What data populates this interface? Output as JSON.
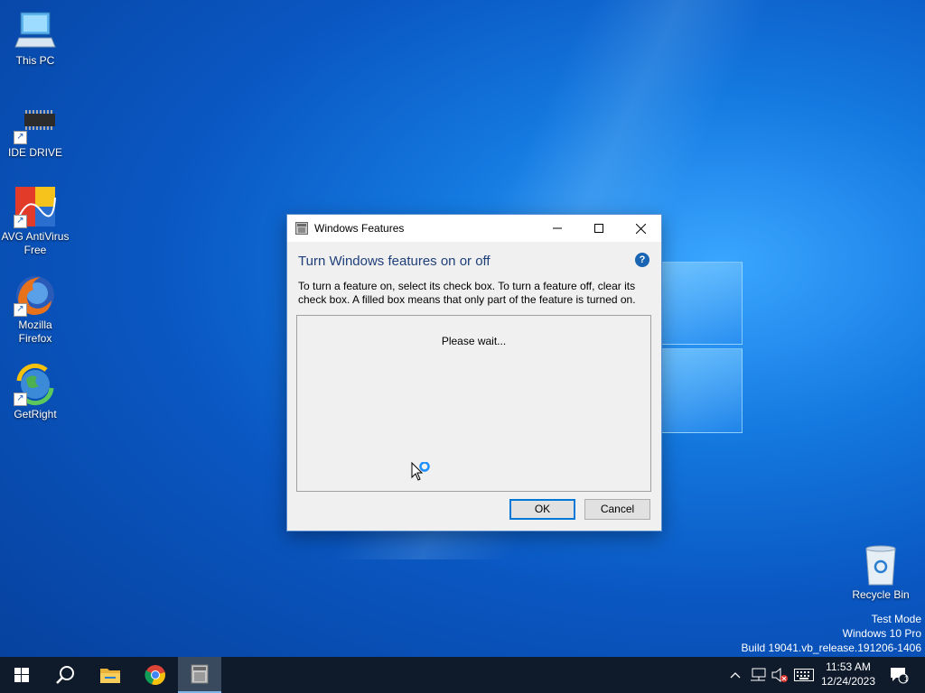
{
  "desktop": {
    "icons": [
      {
        "label_line1": "This PC",
        "label_line2": ""
      },
      {
        "label_line1": "IDE DRIVE",
        "label_line2": ""
      },
      {
        "label_line1": "AVG AntiVirus",
        "label_line2": "Free"
      },
      {
        "label_line1": "Mozilla",
        "label_line2": "Firefox"
      },
      {
        "label_line1": "GetRight",
        "label_line2": ""
      },
      {
        "label_line1": "Recycle Bin",
        "label_line2": ""
      }
    ],
    "watermark": {
      "line1": "Test Mode",
      "line2": "Windows 10 Pro",
      "line3": "Build 19041.vb_release.191206-1406"
    }
  },
  "dialog": {
    "title": "Windows Features",
    "heading": "Turn Windows features on or off",
    "help_glyph": "?",
    "description": "To turn a feature on, select its check box. To turn a feature off, clear its check box. A filled box means that only part of the feature is turned on.",
    "list_status": "Please wait...",
    "ok_label": "OK",
    "cancel_label": "Cancel"
  },
  "taskbar": {
    "pinned": [
      "start-icon",
      "search-icon",
      "file-explorer-icon",
      "chrome-icon",
      "windows-features-icon"
    ],
    "clock": {
      "time": "11:53 AM",
      "date": "12/24/2023"
    },
    "notification_count": "1"
  },
  "colors": {
    "accent": "#0078d7",
    "heading": "#1e3f7a",
    "taskbar": "#0f1a2b"
  }
}
